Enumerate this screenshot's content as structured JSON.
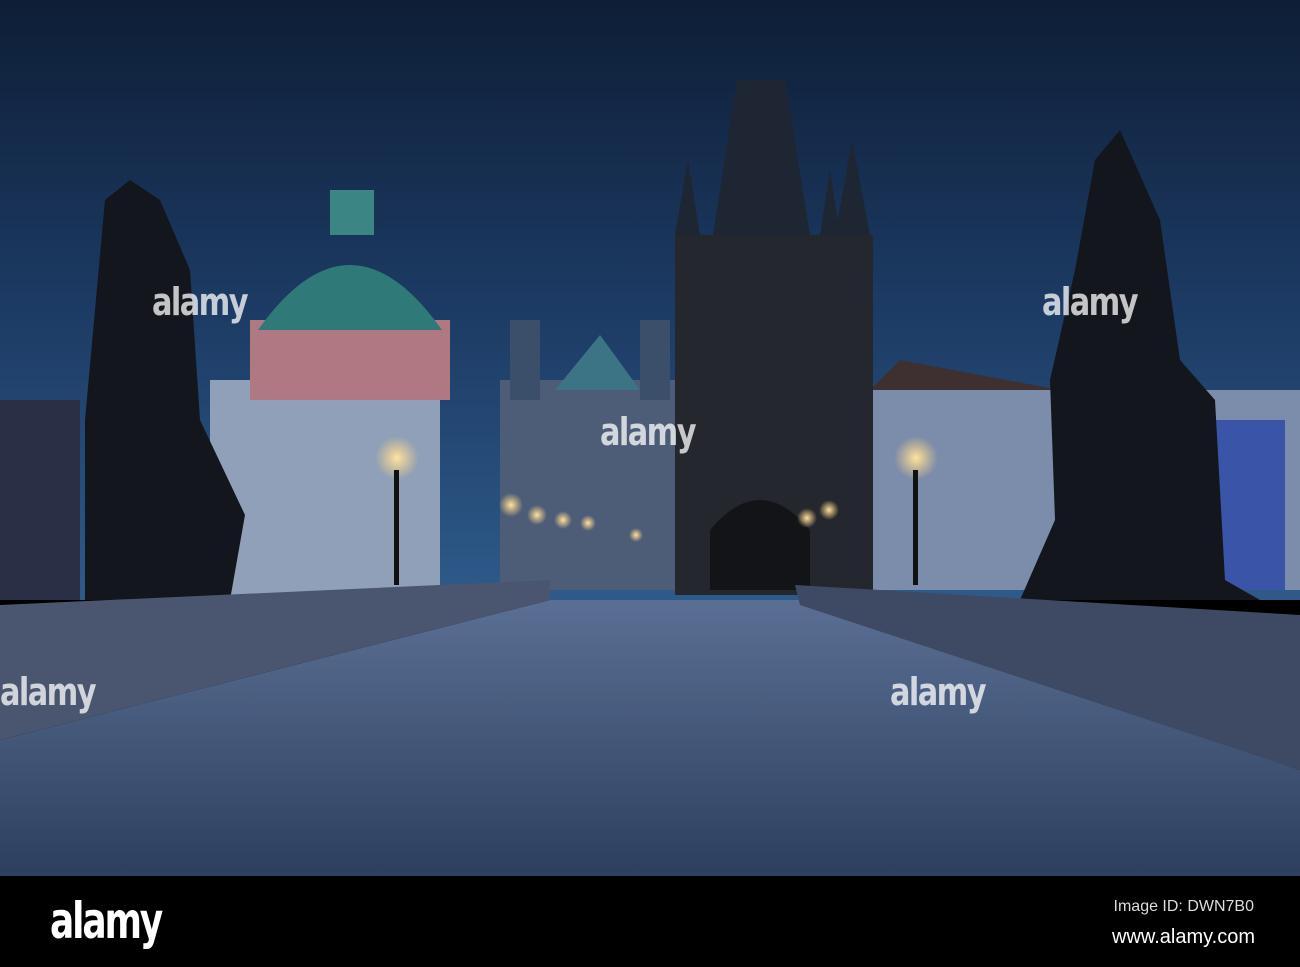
{
  "watermark": "alamy",
  "footer": {
    "logo": "alamy",
    "image_id": "Image ID: DWN7B0",
    "website": "www.alamy.com"
  },
  "colors": {
    "sky_top": "#0e1e36",
    "sky_horizon": "#2e5a8a",
    "stone": "#3a4a66",
    "lamp": "#ffd27a"
  }
}
